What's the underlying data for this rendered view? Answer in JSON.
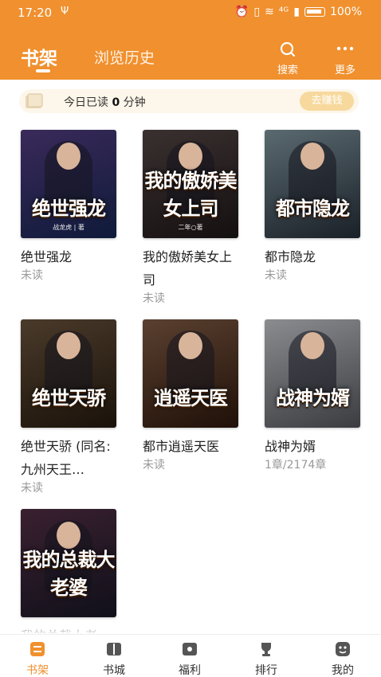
{
  "status_bar": {
    "time": "17:20",
    "usb": "Ψ",
    "network": "⁴ᴳ",
    "battery": "100%"
  },
  "header": {
    "tab_active": "书架",
    "tab_inactive": "浏览历史",
    "search_label": "搜索",
    "more_label": "更多"
  },
  "reading": {
    "prefix": "今日已读",
    "minutes": "0",
    "suffix": "分钟",
    "earn_label": "去赚钱"
  },
  "books": [
    {
      "name": "绝世强龙",
      "status": "未读",
      "cover_title": "绝世强龙",
      "cover_author": "战龙虎 | 著",
      "color1": "#3a2a5a",
      "color2": "#0f1a3a"
    },
    {
      "name": "我的傲娇美女上司",
      "status": "未读",
      "cover_title": "我的傲娇美女上司",
      "cover_author": "二年○著",
      "color1": "#3a3030",
      "color2": "#151010"
    },
    {
      "name": "都市隐龙",
      "status": "未读",
      "cover_title": "都市隐龙",
      "cover_author": "",
      "color1": "#5a6a70",
      "color2": "#1a2028"
    },
    {
      "name": "绝世天骄 (同名:九州天王…",
      "status": "未读",
      "cover_title": "绝世天骄",
      "cover_author": "",
      "color1": "#4a3a2a",
      "color2": "#1a120a"
    },
    {
      "name": "都市逍遥天医",
      "status": "未读",
      "cover_title": "逍遥天医",
      "cover_author": "",
      "color1": "#5a4030",
      "color2": "#201008"
    },
    {
      "name": "战神为婿",
      "status": "1章/2174章",
      "cover_title": "战神为婿",
      "cover_author": "",
      "color1": "#8a8c90",
      "color2": "#3a3c40"
    },
    {
      "name": "我的总裁大老",
      "status": "",
      "cover_title": "我的总裁大老婆",
      "cover_author": "",
      "color1": "#3a2030",
      "color2": "#10101a"
    }
  ],
  "nav": [
    {
      "label": "书架",
      "icon": "bookshelf-icon",
      "active": true
    },
    {
      "label": "书城",
      "icon": "book-icon",
      "active": false
    },
    {
      "label": "福利",
      "icon": "gift-icon",
      "active": false
    },
    {
      "label": "排行",
      "icon": "trophy-icon",
      "active": false
    },
    {
      "label": "我的",
      "icon": "profile-icon",
      "active": false
    }
  ],
  "colors": {
    "accent": "#f0902e"
  }
}
